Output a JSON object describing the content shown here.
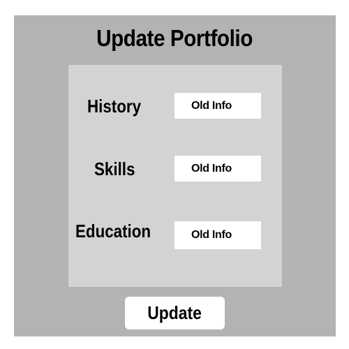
{
  "title": "Update Portfolio",
  "fields": [
    {
      "label": "History",
      "value": "Old Info"
    },
    {
      "label": "Skills",
      "value": "Old Info"
    },
    {
      "label": "Education",
      "value": "Old Info"
    }
  ],
  "update_button": {
    "label": "Update"
  },
  "colors": {
    "outer_panel": "#b3b3b3",
    "form_card": "#d3d3d3",
    "input_bg": "#ffffff",
    "text": "#000000"
  }
}
